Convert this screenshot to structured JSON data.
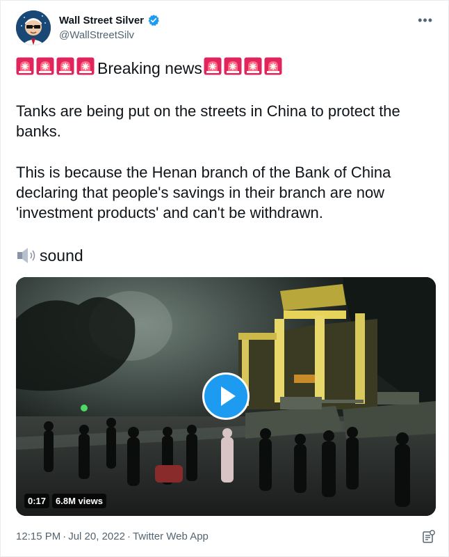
{
  "author": {
    "display_name": "Wall Street Silver",
    "handle": "@WallStreetSilv",
    "verified": true,
    "avatar_icon": "wsb-guy-avatar"
  },
  "more_icon": "more-options-icon",
  "tweet": {
    "headline": "Breaking news",
    "siren_icon": "rotating-light-emoji",
    "siren_count_before": 4,
    "siren_count_after": 4,
    "paragraph_1": "Tanks are being put on the streets in China to protect the banks.",
    "paragraph_2": "This is because the Henan branch of the Bank of China declaring that people's savings in their branch are now 'investment products' and can't be withdrawn.",
    "sound_label": "sound",
    "sound_icon": "speaker-icon"
  },
  "media": {
    "duration": "0:17",
    "views": "6.8M views",
    "play_icon": "play-icon"
  },
  "footer": {
    "time": "12:15 PM",
    "date": "Jul 20, 2022",
    "source": "Twitter Web App",
    "analytics_icon": "analytics-icon"
  },
  "colors": {
    "accent": "#1d9bf0",
    "text": "#0f1419",
    "secondary": "#536471",
    "siren_red": "#e0245e"
  }
}
